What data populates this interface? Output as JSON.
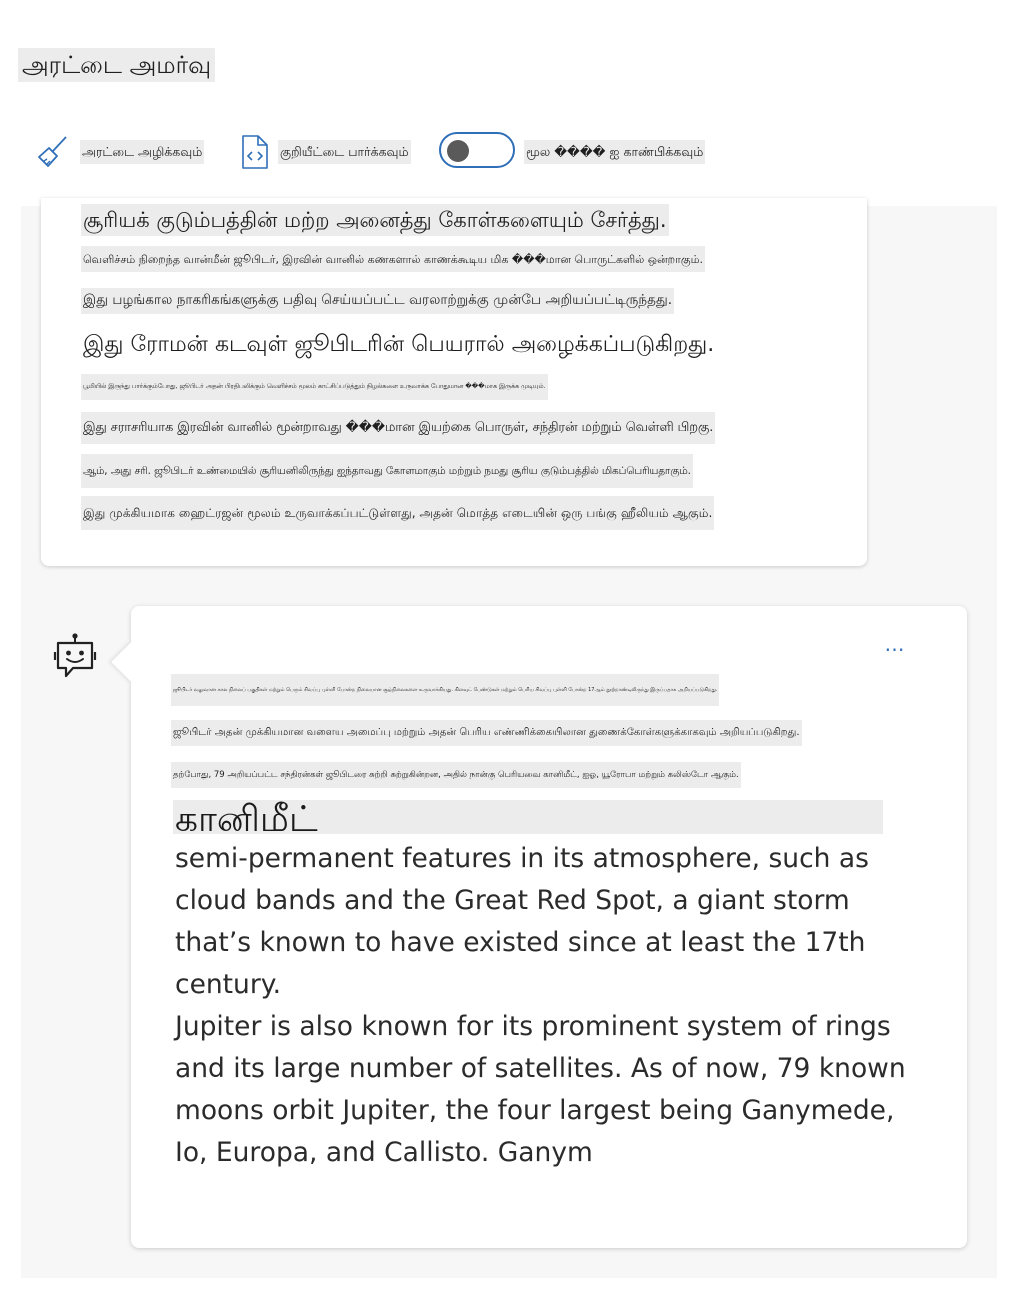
{
  "title": "அரட்டை அமர்வு",
  "toolbar": {
    "clear_label": "அரட்டை அழிக்கவும்",
    "view_code_label": "குறியீட்டை பார்க்கவும்",
    "show_source_label": "மூல ���� ஐ காண்பிக்கவும்",
    "toggle_on": false
  },
  "user_message": {
    "lines": [
      "சூரியக் குடும்பத்தின் மற்ற அனைத்து கோள்களையும் சேர்த்து.",
      "வெளிச்சம் நிறைந்த வான்மீன் ஜூபிடர், இரவின் வானில் கணகளால் காணக்கூடிய மிக ���மான பொருட்களில் ஒன்றாகும்.",
      "இது பழங்கால நாகரிகங்களுக்கு பதிவு செய்யப்பட்ட வரலாற்றுக்கு முன்பே அறியப்பட்டிருந்தது.",
      "இது ரோமன் கடவுள் ஜூபிடரின் பெயரால் அழைக்கப்படுகிறது.",
      "பூமியில் இருந்து பார்க்கும்போது, ஜூபிடர் அதன் பிரதிபலிக்கும் வெளிச்சம் மூலம் காட்சிப்படுத்தும் நிழல்களை உருவாக்க போதுமான ���மாக இருக்க முடியும்.",
      "இது சராசரியாக இரவின் வானில் மூன்றாவது ���மான இயற்கை பொருள், சந்திரன் மற்றும் வெள்ளி பிறகு.",
      "ஆம், அது சரி. ஜூபிடர் உண்மையில் சூரியனிலிருந்து ஐந்தாவது கோளமாகும் மற்றும் நமது சூரிய குடும்பத்தில் மிகப்பெரியதாகும்.",
      "இது முக்கியமாக ஹைட்ரஜன் மூலம் உருவாக்கப்பட்டுள்ளது, அதன் மொத்த எடையின் ஒரு பங்கு ஹீலியம் ஆகும்."
    ]
  },
  "bot_message": {
    "more_label": "…",
    "lines": [
      "ஜூபிடர் வலுவான கால நிலைப் பகுதிகள் மற்றும் பெரும் சிவப்பு புள்ளி போன்ற நிலையான சூழ்நிலைகளை உருவாக்கியது. கிளவுட் பேண்டுகள் மற்றும் பெரிய சிவப்பு புள்ளி போன்ற 17ஆம் நூற்றாண்டிலிருந்து இருப்பதாக அறியப்படுகிறது.",
      "ஜூபிடர் அதன் முக்கியமான வளைய அமைப்பு மற்றும் அதன் பெரிய எண்ணிக்கையிலான துணைக்கோள்களுக்காகவும் அறியப்படுகிறது.",
      "தற்போது, 79 அறியப்பட்ட சந்திரன்கள் ஜூபிடரை சுற்றி சுற்றுகின்றன, அதில் நான்கு பெரியவை கானிமீட், ஐஓ, யூரோபா மற்றும் கலிஸ்டோ ஆகும்."
    ],
    "heading": "கானிமீட்",
    "paragraph1": "semi-permanent features in its atmosphere, such as cloud bands and the Great Red Spot, a giant storm that’s known to have existed since at least the 17th century.",
    "paragraph2": "Jupiter is also known for its prominent system of rings and its large number of satellites. As of now, 79 known moons orbit Jupiter, the four largest being Ganymede, Io, Europa, and Callisto. Ganym"
  }
}
